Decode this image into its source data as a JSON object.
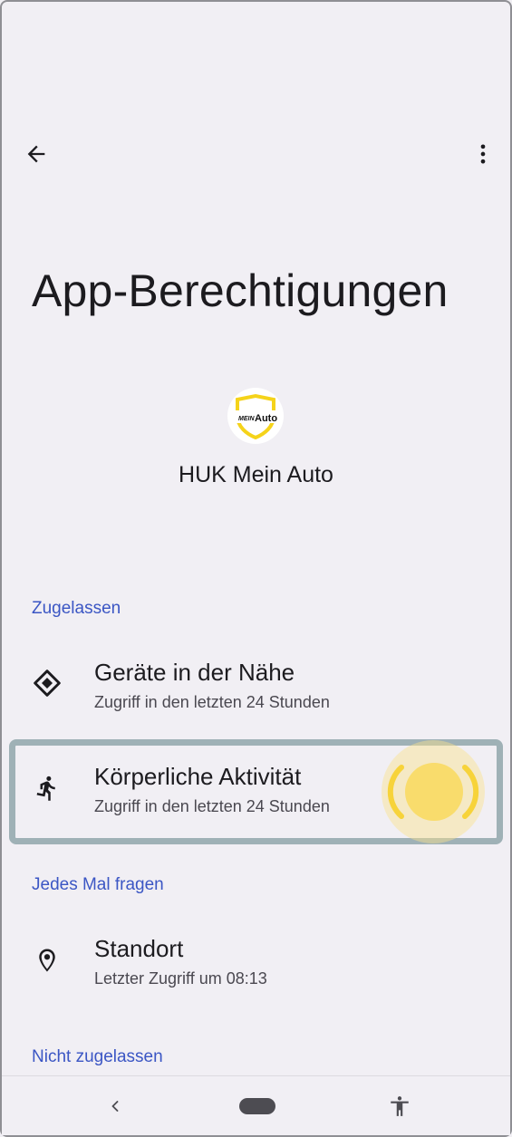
{
  "header": {
    "back_icon": "arrow-left-icon",
    "more_icon": "more-vert-icon",
    "title": "App-Berechtigungen"
  },
  "app": {
    "name": "HUK Mein Auto",
    "logo_text_mein": "MEIN",
    "logo_text_auto": "Auto"
  },
  "sections": {
    "allowed": "Zugelassen",
    "ask_every_time": "Jedes Mal fragen",
    "not_allowed": "Nicht zugelassen"
  },
  "permissions": {
    "nearby_devices": {
      "title": "Geräte in der Nähe",
      "subtitle": "Zugriff in den letzten 24 Stunden",
      "icon": "nearby-devices-icon"
    },
    "physical_activity": {
      "title": "Körperliche Aktivität",
      "subtitle": "Zugriff in den letzten 24 Stunden",
      "icon": "running-person-icon"
    },
    "location": {
      "title": "Standort",
      "subtitle": "Letzter Zugriff um 08:13",
      "icon": "location-pin-icon"
    }
  },
  "navbar": {
    "back_icon": "chevron-left-icon",
    "home_icon": "home-pill-icon",
    "accessibility_icon": "accessibility-icon"
  },
  "colors": {
    "background": "#f1eff4",
    "section_header": "#3b56c4",
    "highlight_border": "#9fb1b6",
    "tap_indicator": "#f9dc6c",
    "logo_yellow": "#f5d31a"
  }
}
